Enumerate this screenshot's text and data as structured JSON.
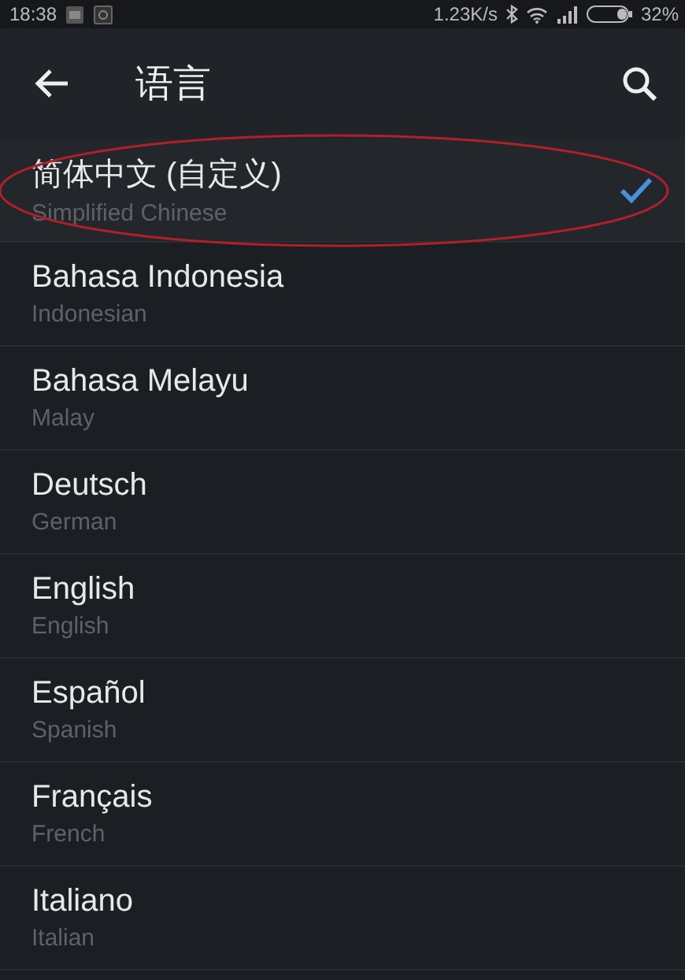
{
  "status_bar": {
    "time": "18:38",
    "speed": "1.23K/s",
    "battery": "32%"
  },
  "header": {
    "title": "语言"
  },
  "languages": [
    {
      "name": "简体中文 (自定义)",
      "subtitle": "Simplified Chinese",
      "selected": true
    },
    {
      "name": "Bahasa Indonesia",
      "subtitle": "Indonesian",
      "selected": false
    },
    {
      "name": "Bahasa Melayu",
      "subtitle": "Malay",
      "selected": false
    },
    {
      "name": "Deutsch",
      "subtitle": "German",
      "selected": false
    },
    {
      "name": "English",
      "subtitle": "English",
      "selected": false
    },
    {
      "name": "Español",
      "subtitle": "Spanish",
      "selected": false
    },
    {
      "name": "Français",
      "subtitle": "French",
      "selected": false
    },
    {
      "name": "Italiano",
      "subtitle": "Italian",
      "selected": false
    }
  ]
}
